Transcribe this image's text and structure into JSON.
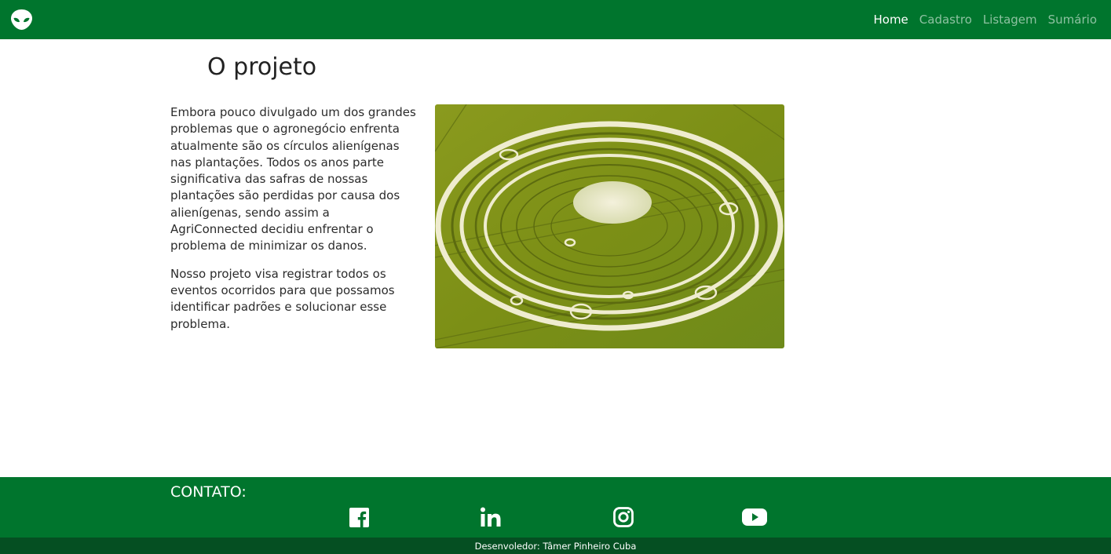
{
  "nav": {
    "brand_icon": "alien-icon",
    "items": [
      {
        "label": "Home",
        "active": true
      },
      {
        "label": "Cadastro",
        "active": false
      },
      {
        "label": "Listagem",
        "active": false
      },
      {
        "label": "Sumário",
        "active": false
      }
    ]
  },
  "main": {
    "title": "O projeto",
    "paragraphs": [
      "Embora pouco divulgado um dos grandes problemas que o agronegócio enfrenta atualmente são os círculos alienígenas nas plantações. Todos os anos parte significativa das safras de nossas plantações são perdidas por causa dos alienígenas, sendo assim a AgriConnected decidiu enfrentar o problema de minimizar os danos.",
      "Nosso projeto visa registrar todos os eventos ocorridos para que possamos identificar padrões e solucionar esse problema."
    ],
    "image_subject": "crop-circle-photo"
  },
  "footer": {
    "contact_label": "CONTATO:",
    "social": [
      "facebook-icon",
      "linkedin-icon",
      "instagram-icon",
      "youtube-icon"
    ],
    "developer": "Desenvoledor: Tâmer Pinheiro Cuba"
  },
  "colors": {
    "primary_green": "#00752d",
    "dark_green": "#054f22"
  }
}
